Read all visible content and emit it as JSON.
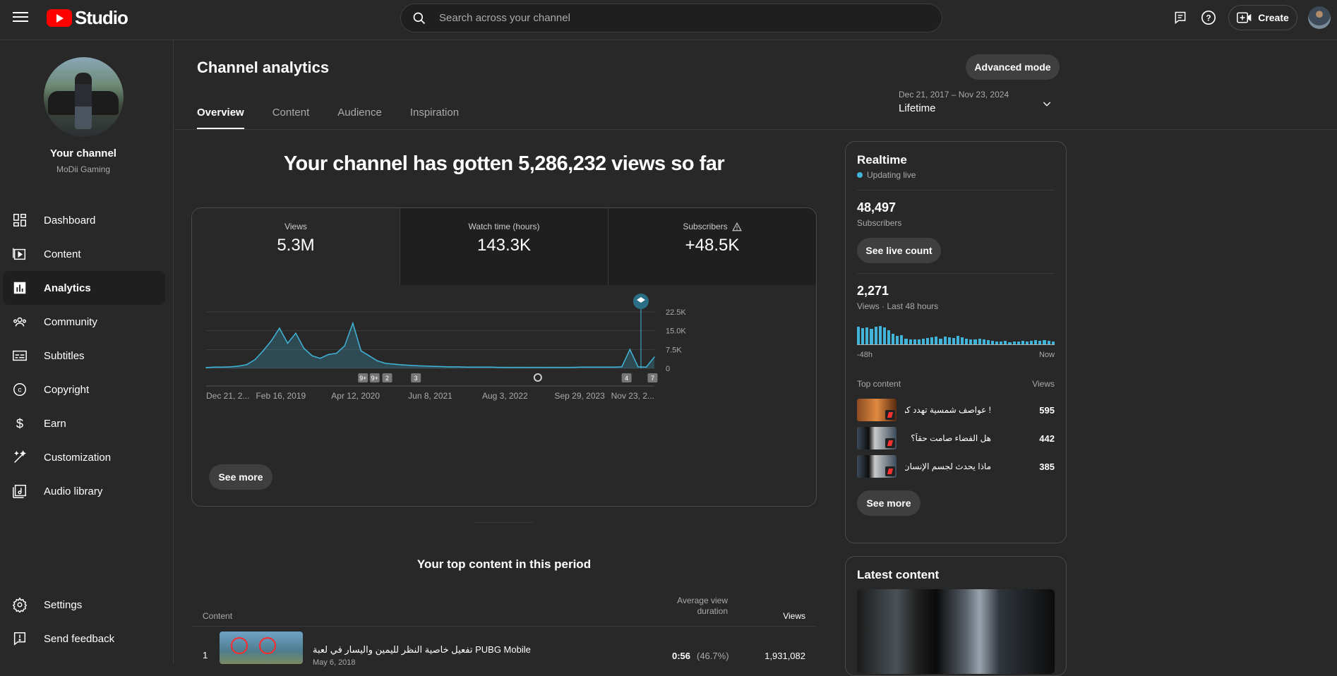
{
  "app": {
    "logo_text": "Studio",
    "brand_color": "#ff0000",
    "accent_color": "#41b4d9"
  },
  "search": {
    "placeholder": "Search across your channel"
  },
  "header": {
    "create_label": "Create"
  },
  "channel": {
    "your_channel_label": "Your channel",
    "name": "MoDii Gaming"
  },
  "sidebar": {
    "items": [
      {
        "label": "Dashboard",
        "icon": "dashboard-icon"
      },
      {
        "label": "Content",
        "icon": "content-icon"
      },
      {
        "label": "Analytics",
        "icon": "analytics-icon",
        "active": true
      },
      {
        "label": "Community",
        "icon": "community-icon"
      },
      {
        "label": "Subtitles",
        "icon": "subtitles-icon"
      },
      {
        "label": "Copyright",
        "icon": "copyright-icon"
      },
      {
        "label": "Earn",
        "icon": "earn-icon"
      },
      {
        "label": "Customization",
        "icon": "customization-icon"
      },
      {
        "label": "Audio library",
        "icon": "audio-library-icon"
      }
    ],
    "settings_label": "Settings",
    "feedback_label": "Send feedback"
  },
  "page": {
    "title": "Channel analytics",
    "advanced_mode_label": "Advanced mode",
    "tabs": [
      "Overview",
      "Content",
      "Audience",
      "Inspiration"
    ],
    "active_tab": "Overview",
    "date_range": {
      "range": "Dec 21, 2017 – Nov 23, 2024",
      "label": "Lifetime"
    },
    "headline": "Your channel has gotten 5,286,232 views so far"
  },
  "metrics": [
    {
      "label": "Views",
      "value": "5.3M"
    },
    {
      "label": "Watch time (hours)",
      "value": "143.3K"
    },
    {
      "label": "Subscribers",
      "value": "+48.5K",
      "warning": true
    }
  ],
  "chart_data": {
    "type": "line",
    "x_tick_labels": [
      "Dec 21, 2...",
      "Feb 16, 2019",
      "Apr 12, 2020",
      "Jun 8, 2021",
      "Aug 3, 2022",
      "Sep 29, 2023",
      "Nov 23, 2..."
    ],
    "y_tick_labels": [
      "22.5K",
      "15.0K",
      "7.5K",
      "0"
    ],
    "ylim": [
      0,
      22500
    ],
    "grid": true,
    "series": [
      {
        "values": [
          300,
          500,
          500,
          600,
          900,
          1500,
          3500,
          7000,
          11000,
          16000,
          10000,
          14000,
          8000,
          5000,
          4000,
          5500,
          6000,
          9000,
          18000,
          7000,
          5000,
          3000,
          2000,
          1700,
          1400,
          1200,
          1000,
          900,
          800,
          700,
          600,
          600,
          500,
          500,
          500,
          500,
          400,
          400,
          400,
          400,
          400,
          400,
          400,
          400,
          400,
          400,
          500,
          500,
          500,
          500,
          500,
          600,
          7500,
          600,
          500,
          4500
        ]
      }
    ],
    "markers": [
      "9+",
      "9+",
      "2",
      "3",
      "4",
      "7"
    ]
  },
  "card": {
    "see_more_label": "See more"
  },
  "top_content": {
    "title": "Your top content in this period",
    "headers": {
      "content": "Content",
      "avg": "Average view duration",
      "views": "Views"
    },
    "rows": [
      {
        "rank": "1",
        "title": "تفعيل خاصية النظر لليمين واليسار في لعبة PUBG Mobile",
        "date": "May 6, 2018",
        "avg": "0:56",
        "avg_pct": "(46.7%)",
        "views": "1,931,082"
      }
    ]
  },
  "realtime": {
    "title": "Realtime",
    "status": "Updating live",
    "subscribers_value": "48,497",
    "subscribers_label": "Subscribers",
    "see_live_label": "See live count",
    "views_value": "2,271",
    "views_label": "Views · Last 48 hours",
    "bars": [
      0.75,
      0.7,
      0.72,
      0.66,
      0.75,
      0.8,
      0.72,
      0.6,
      0.45,
      0.35,
      0.4,
      0.25,
      0.2,
      0.22,
      0.2,
      0.25,
      0.28,
      0.3,
      0.32,
      0.25,
      0.33,
      0.3,
      0.28,
      0.35,
      0.3,
      0.25,
      0.2,
      0.22,
      0.25,
      0.2,
      0.18,
      0.15,
      0.12,
      0.12,
      0.15,
      0.1,
      0.12,
      0.12,
      0.15,
      0.12,
      0.15,
      0.18,
      0.15,
      0.18,
      0.15,
      0.12
    ],
    "axis_start": "-48h",
    "axis_end": "Now",
    "top_content_label": "Top content",
    "views_col_label": "Views",
    "items": [
      {
        "title": "! عواصف شمسية تهدد كوكبنا",
        "views": "595"
      },
      {
        "title": "هل الفضاء صامت حقاً؟",
        "views": "442"
      },
      {
        "title": "ماذا يحدث لجسم الإنسان في الفضاء ؟",
        "views": "385"
      }
    ],
    "see_more_label": "See more"
  },
  "latest": {
    "title": "Latest content"
  }
}
